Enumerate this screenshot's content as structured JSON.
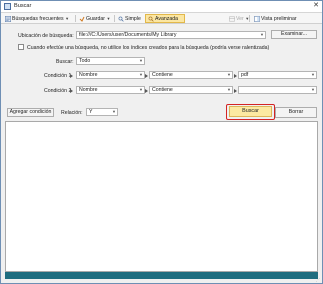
{
  "window": {
    "title": "Buscar",
    "close_glyph": "✕"
  },
  "toolbar": {
    "frequent_label": "Búsquedas frecuentes",
    "save_label": "Guardar",
    "simple_label": "Simple",
    "advanced_label": "Avanzada",
    "view_label": "Ver",
    "preview_label": "Vista preliminar"
  },
  "search": {
    "location_label": "Ubicación de búsqueda:",
    "location_value": "file:///C:/Users/user/Documents/My Library",
    "browse_label": "Examinar...",
    "no_index_label": "Cuando efectúe una búsqueda, no utilice los índices creados para la búsqueda (podría verse ralentizada)",
    "no_index_checked": false,
    "scope_label": "Buscar:",
    "scope_value": "Todo",
    "condition1_label": "Condición 1",
    "condition1_field": "Nombre",
    "condition1_operator": "Contiene",
    "condition1_value": "pdf",
    "condition2_label": "Condición 2",
    "condition2_field": "Nombre",
    "condition2_operator": "Contiene",
    "condition2_value": "",
    "add_condition_label": "Agregar condición",
    "relation_label": "Relación:",
    "relation_value": "Y",
    "search_button_label": "Buscar",
    "clear_button_label": "Borrar"
  },
  "colors": {
    "highlight": "#d42424",
    "search_button_bg": "#fce9a2",
    "status_bar": "#1f6d7f"
  }
}
